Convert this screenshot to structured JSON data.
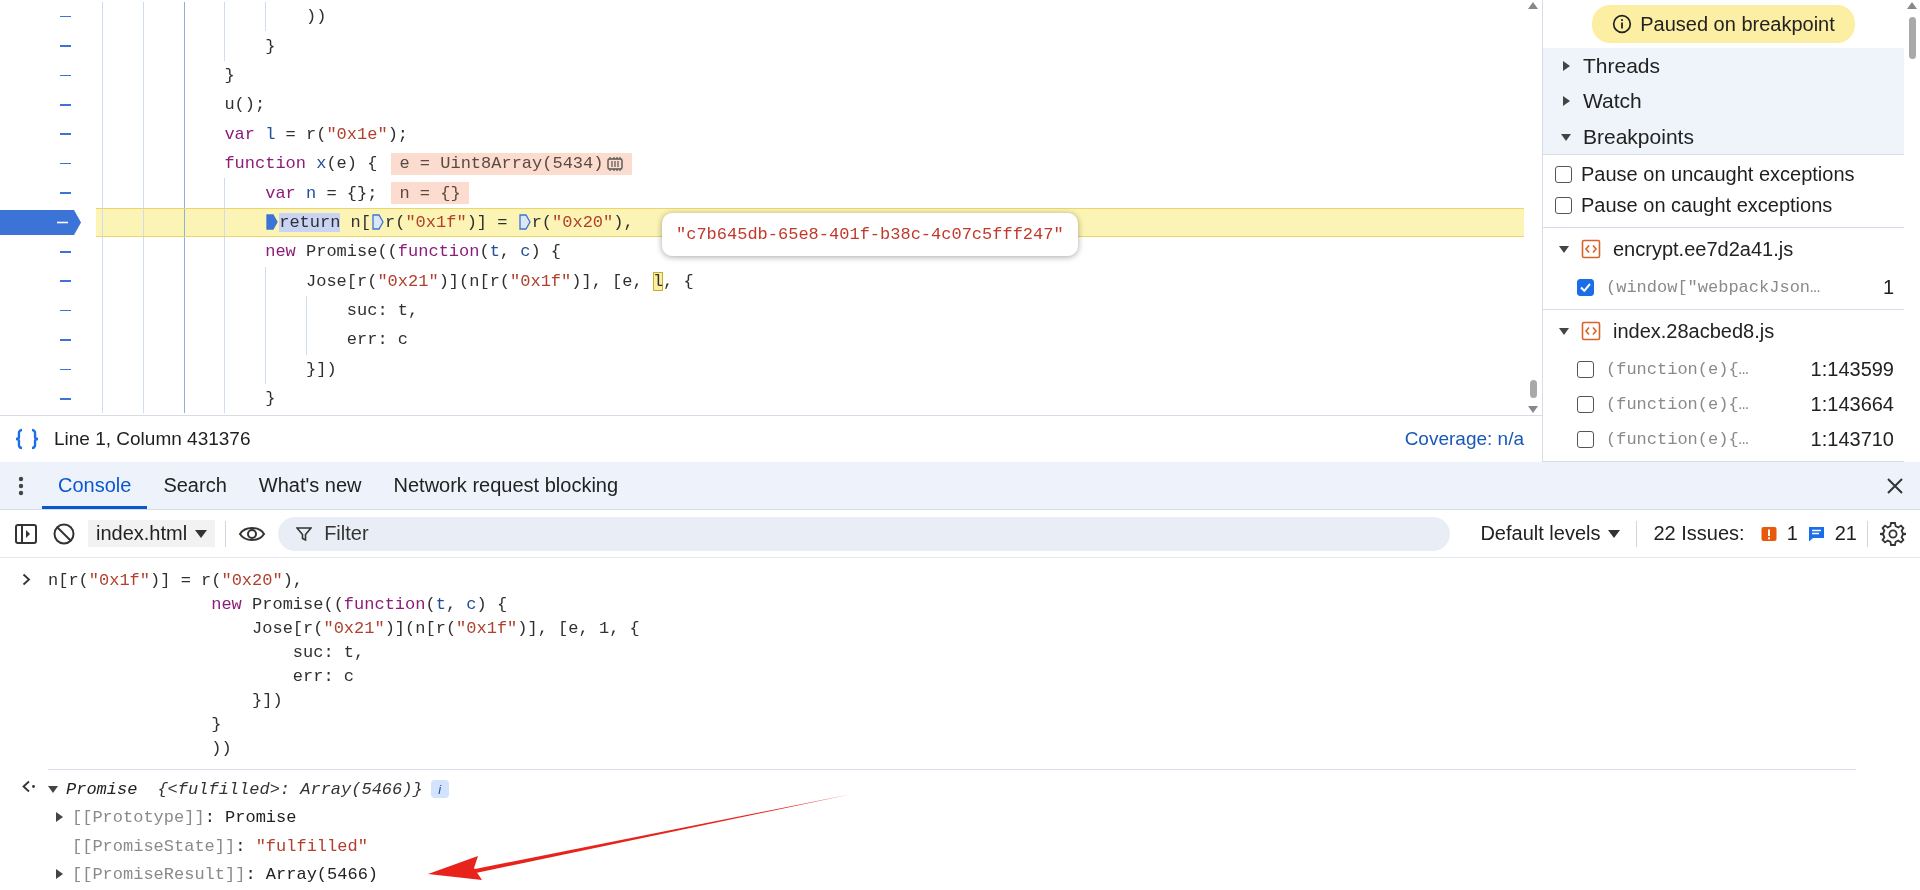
{
  "editor": {
    "lines": [
      {
        "segments": [
          {
            "kind": "plain",
            "text": "                    ))"
          }
        ]
      },
      {
        "segments": [
          {
            "kind": "plain",
            "text": "                }"
          }
        ]
      },
      {
        "segments": [
          {
            "kind": "plain",
            "text": "            }"
          }
        ]
      },
      {
        "segments": [
          {
            "kind": "plain",
            "text": "            u();"
          }
        ]
      },
      {
        "segments": [
          {
            "kind": "keyword",
            "text": "            var"
          },
          {
            "kind": "variable",
            "text": " l"
          },
          {
            "kind": "plain",
            "text": " = r("
          },
          {
            "kind": "string",
            "text": "\"0x1e\""
          },
          {
            "kind": "plain",
            "text": ");"
          }
        ]
      },
      {
        "segments": [
          {
            "kind": "keyword",
            "text": "            function"
          },
          {
            "kind": "variable",
            "text": " x"
          },
          {
            "kind": "plain",
            "text": "(e) {"
          }
        ],
        "inline_values": [
          {
            "text": "e = Uint8Array(5434)",
            "kind": "memory"
          }
        ]
      },
      {
        "segments": [
          {
            "kind": "keyword",
            "text": "                var"
          },
          {
            "kind": "variable",
            "text": " n"
          },
          {
            "kind": "plain",
            "text": " = {};"
          }
        ],
        "inline_values": [
          {
            "text": "n = {}",
            "kind": "plain"
          }
        ]
      },
      {
        "paused": true,
        "segments": [
          {
            "kind": "marker",
            "active": true
          },
          {
            "kind": "selected",
            "text": "return"
          },
          {
            "kind": "plain",
            "text": " n["
          },
          {
            "kind": "marker",
            "active": false
          },
          {
            "kind": "plain",
            "text": "r("
          },
          {
            "kind": "string",
            "text": "\"0x1f\""
          },
          {
            "kind": "plain",
            "text": ")] = "
          },
          {
            "kind": "marker",
            "active": false
          },
          {
            "kind": "plain",
            "text": "r("
          },
          {
            "kind": "string",
            "text": "\"0x20\""
          },
          {
            "kind": "plain",
            "text": "),"
          }
        ]
      },
      {
        "segments": [
          {
            "kind": "keyword",
            "text": "                new"
          },
          {
            "kind": "plain",
            "text": " Promise(("
          },
          {
            "kind": "keyword",
            "text": "function"
          },
          {
            "kind": "plain",
            "text": "("
          },
          {
            "kind": "variable",
            "text": "t"
          },
          {
            "kind": "plain",
            "text": ", "
          },
          {
            "kind": "variable",
            "text": "c"
          },
          {
            "kind": "plain",
            "text": ") {"
          }
        ]
      },
      {
        "segments": [
          {
            "kind": "plain",
            "text": "                    Jose[r("
          },
          {
            "kind": "string",
            "text": "\"0x21\""
          },
          {
            "kind": "plain",
            "text": ")](n[r("
          },
          {
            "kind": "string",
            "text": "\"0x1f\""
          },
          {
            "kind": "plain",
            "text": ")], [e, "
          },
          {
            "kind": "boxed",
            "text": "l"
          },
          {
            "kind": "plain",
            "text": ", {"
          }
        ]
      },
      {
        "segments": [
          {
            "kind": "plain",
            "text": "                        suc: t,"
          }
        ]
      },
      {
        "segments": [
          {
            "kind": "plain",
            "text": "                        err: c"
          }
        ]
      },
      {
        "segments": [
          {
            "kind": "plain",
            "text": "                    }])"
          }
        ]
      },
      {
        "segments": [
          {
            "kind": "plain",
            "text": "                }"
          }
        ]
      }
    ],
    "tooltip": "\"c7b645db-65e8-401f-b38c-4c07c5fff247\"",
    "status_bar": {
      "position": "Line 1, Column 431376",
      "coverage": "Coverage: n/a"
    }
  },
  "debugger_sidebar": {
    "banner": "Paused on breakpoint",
    "sections": [
      {
        "label": "Threads",
        "expanded": false
      },
      {
        "label": "Watch",
        "expanded": false
      },
      {
        "label": "Breakpoints",
        "expanded": true
      }
    ],
    "exception_options": [
      {
        "label": "Pause on uncaught exceptions",
        "checked": false
      },
      {
        "label": "Pause on caught exceptions",
        "checked": false
      }
    ],
    "files": [
      {
        "name": "encrypt.ee7d2a41.js",
        "expanded": true,
        "breakpoints": [
          {
            "code": "(window[\"webpackJson…",
            "location": "1",
            "checked": true
          }
        ]
      },
      {
        "name": "index.28acbed8.js",
        "expanded": true,
        "breakpoints": [
          {
            "code": "(function(e){…",
            "location": "1:143599",
            "checked": false
          },
          {
            "code": "(function(e){…",
            "location": "1:143664",
            "checked": false
          },
          {
            "code": "(function(e){…",
            "location": "1:143710",
            "checked": false
          }
        ]
      }
    ]
  },
  "drawer": {
    "tabs": [
      {
        "label": "Console",
        "selected": true
      },
      {
        "label": "Search",
        "selected": false
      },
      {
        "label": "What's new",
        "selected": false
      },
      {
        "label": "Network request blocking",
        "selected": false
      }
    ],
    "toolbar": {
      "context": "index.html",
      "filter_placeholder": "Filter",
      "levels": "Default levels",
      "issues_label": "22 Issues:",
      "issue_counts": [
        {
          "kind": "warning",
          "count": "1"
        },
        {
          "kind": "info",
          "count": "21"
        }
      ]
    }
  },
  "console": {
    "input_lines": [
      [
        {
          "kind": "plain",
          "text": "n[r("
        },
        {
          "kind": "string",
          "text": "\"0x1f\""
        },
        {
          "kind": "plain",
          "text": ")] = r("
        },
        {
          "kind": "string",
          "text": "\"0x20\""
        },
        {
          "kind": "plain",
          "text": "),"
        }
      ],
      [
        {
          "kind": "keyword",
          "text": "                new"
        },
        {
          "kind": "plain",
          "text": " Promise(("
        },
        {
          "kind": "keyword",
          "text": "function"
        },
        {
          "kind": "plain",
          "text": "("
        },
        {
          "kind": "variable",
          "text": "t"
        },
        {
          "kind": "plain",
          "text": ", "
        },
        {
          "kind": "variable",
          "text": "c"
        },
        {
          "kind": "plain",
          "text": ") {"
        }
      ],
      [
        {
          "kind": "plain",
          "text": "                    Jose[r("
        },
        {
          "kind": "string",
          "text": "\"0x21\""
        },
        {
          "kind": "plain",
          "text": ")](n[r("
        },
        {
          "kind": "string",
          "text": "\"0x1f\""
        },
        {
          "kind": "plain",
          "text": ")], [e, 1, {"
        }
      ],
      [
        {
          "kind": "plain",
          "text": "                        suc: t,"
        }
      ],
      [
        {
          "kind": "plain",
          "text": "                        err: c"
        }
      ],
      [
        {
          "kind": "plain",
          "text": "                    }])"
        }
      ],
      [
        {
          "kind": "plain",
          "text": "                }"
        }
      ],
      [
        {
          "kind": "plain",
          "text": "                ))"
        }
      ]
    ],
    "result": {
      "type_name": "Promise",
      "summary": "{<fulfilled>: Array(5466)}",
      "info_badge": "i",
      "expanded": true,
      "properties": [
        {
          "kind": "expandable",
          "expanded": false,
          "name": "[[Prototype]]",
          "separator": ":",
          "value": {
            "kind": "plain",
            "text": "Promise"
          }
        },
        {
          "kind": "leaf",
          "name": "[[PromiseState]]",
          "separator": ":",
          "value": {
            "kind": "string",
            "text": "\"fulfilled\""
          }
        },
        {
          "kind": "expandable",
          "expanded": false,
          "name": "[[PromiseResult]]",
          "separator": ":",
          "value": {
            "kind": "plain",
            "text": "Array(5466)"
          }
        }
      ]
    }
  }
}
